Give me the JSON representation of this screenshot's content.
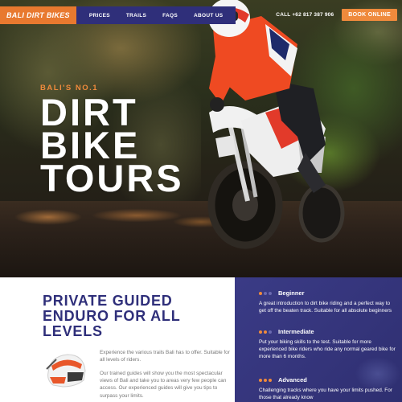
{
  "nav": {
    "logo": "BALI DIRT BIKES",
    "menu": [
      "PRICES",
      "TRAILS",
      "FAQS",
      "ABOUT US"
    ],
    "phone": "CALL +62 817 387 906",
    "book": "BOOK ONLINE"
  },
  "hero": {
    "eyebrow": "BALI'S NO.1",
    "headline": [
      "DIRT",
      "BIKE",
      "TOURS"
    ]
  },
  "intro": {
    "title": "PRIVATE GUIDED ENDURO FOR ALL LEVELS",
    "p1": "Experience the various trails Bali has to offer. Suitable for all levels of riders.",
    "p2": "Our trained guides will show you the most spectacular views of Bali and take you to areas very few people can access. Our experienced guides will give you tips to surpass your limits."
  },
  "levels": [
    {
      "name": "Beginner",
      "desc": "A great introduction to dirt bike riding and a perfect way to get off the beaten track. Suitable for all absolute beginners",
      "dots": 1
    },
    {
      "name": "Intermediate",
      "desc": "Put your biking skills to the test. Suitable for more experienced bike riders who ride any normal geared bike for more than 6 months.",
      "dots": 2
    },
    {
      "name": "Advanced",
      "desc": "Challenging tracks where you have your limits pushed. For those that already know",
      "dots": 3
    }
  ],
  "colors": {
    "accent": "#ef8a3c",
    "navy": "#2f2f7a",
    "panel": "#34347a"
  }
}
